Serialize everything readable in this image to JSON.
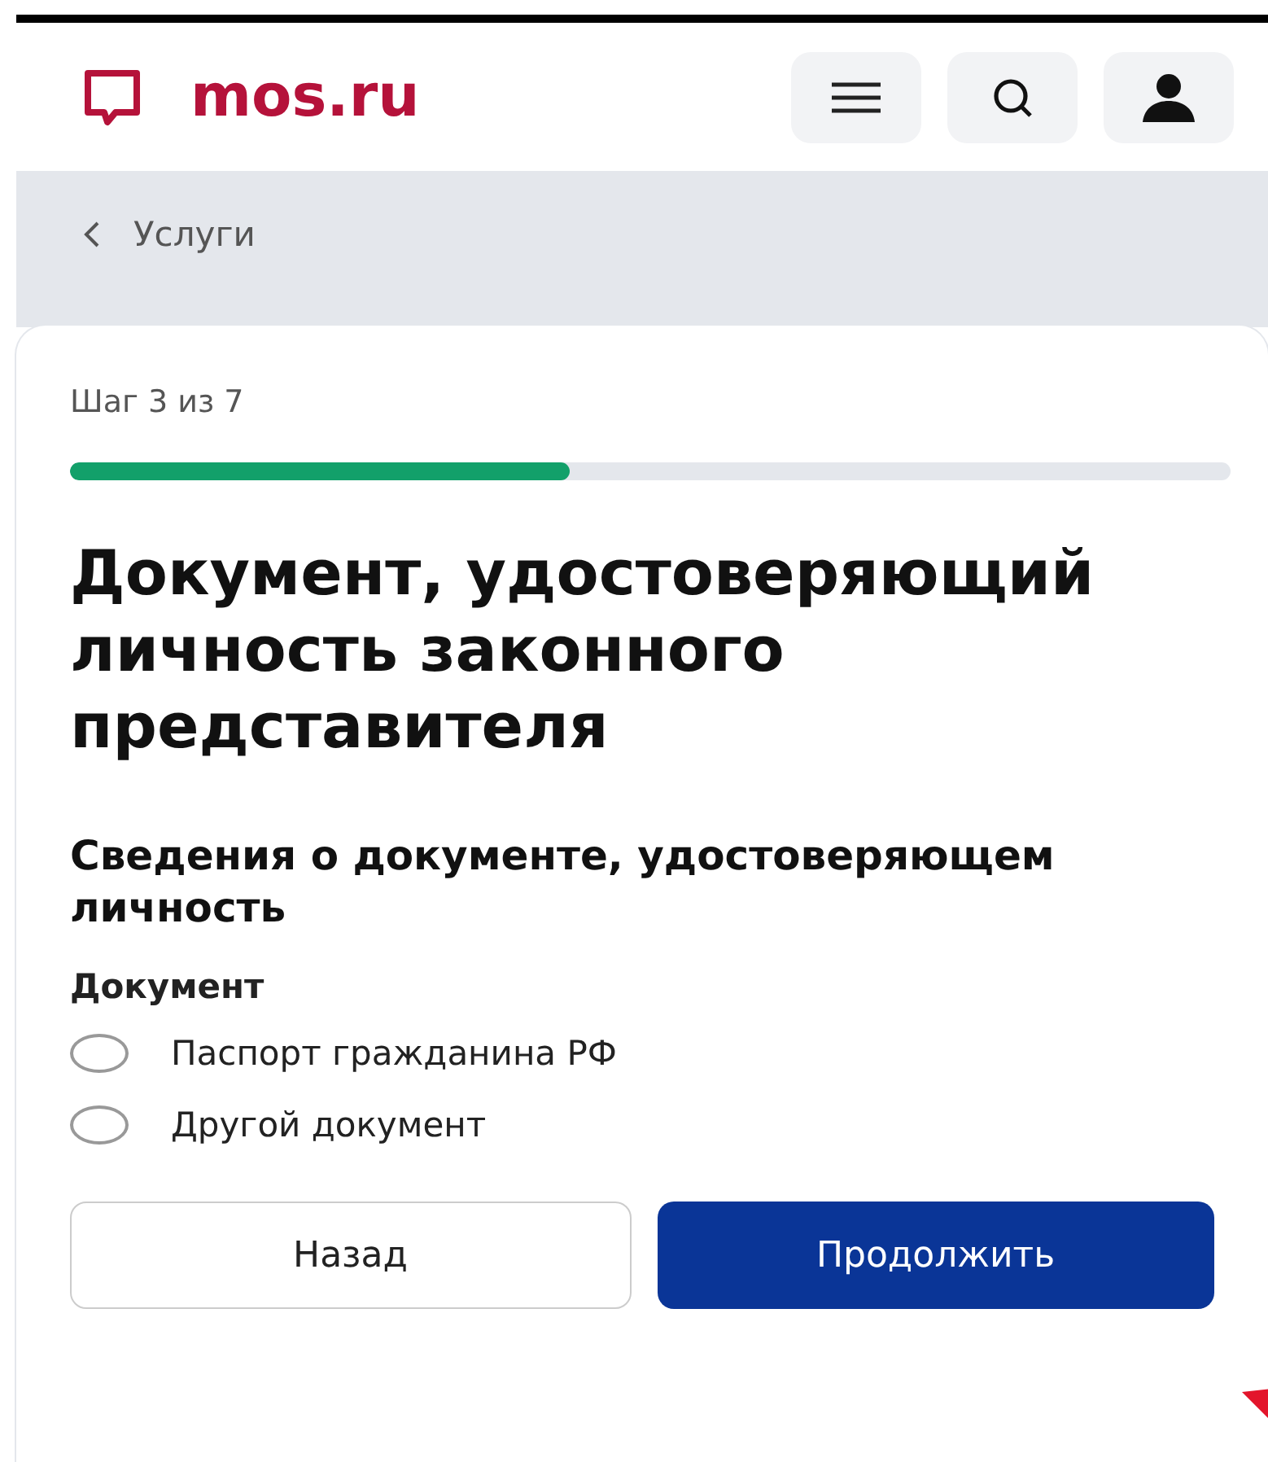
{
  "header": {
    "logo": "mos.ru"
  },
  "breadcrumb": {
    "label": "Услуги"
  },
  "form": {
    "step": "Шаг 3 из 7",
    "progress": {
      "level": 0.43
    },
    "title": "Документ, удостоверяющий личность законного представителя",
    "section_title": "Сведения о документе, удостоверяющем личность",
    "field_label": "Документ",
    "options": [
      {
        "label": "Паспорт гражданина РФ",
        "selected": false
      },
      {
        "label": "Другой документ",
        "selected": false
      }
    ],
    "buttons": [
      {
        "label": "Назад",
        "kind": "secondary"
      },
      {
        "label": "Продолжить",
        "kind": "primary"
      }
    ]
  }
}
